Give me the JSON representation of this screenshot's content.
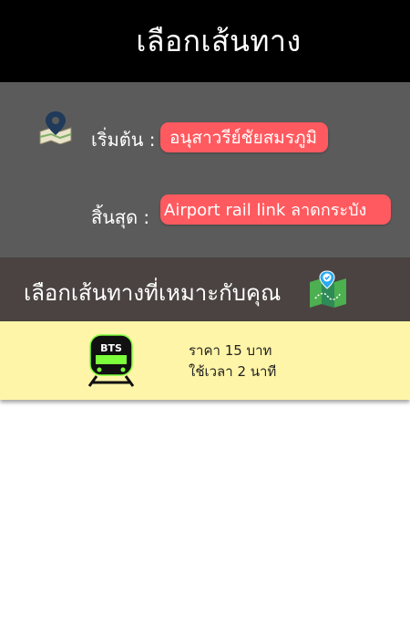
{
  "header": {
    "title": "เลือกเส้นทาง"
  },
  "route": {
    "start_label": "เริ่มต้น :",
    "start_value": "อนุสาวรีย์ชัยสมรภูมิ",
    "end_label": "สิ้นสุด :",
    "end_value": "Airport rail link ลาดกระบัง",
    "icon": "map-pin-icon"
  },
  "section": {
    "title": "เลือกเส้นทางที่เหมาะกับคุณ",
    "icon": "route-map-icon"
  },
  "options": [
    {
      "icon": "bts-train-icon",
      "icon_text": "BTS",
      "price": "ราคา 15 บาท",
      "time": "ใช้เวลา 2 นาที"
    }
  ],
  "colors": {
    "header_bg": "#000000",
    "panel_bg": "#5b5b5b",
    "pill_bg": "#ff5a5f",
    "section_bg": "#4a4341",
    "option_bg": "#fff5a8",
    "train_green": "#7cff3a"
  }
}
